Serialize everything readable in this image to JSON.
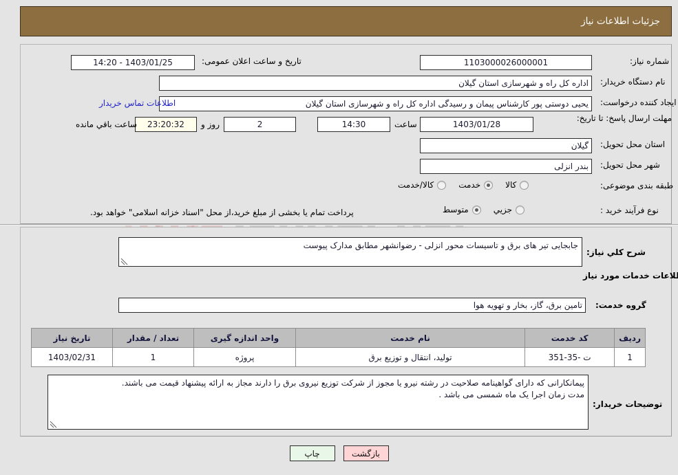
{
  "header": {
    "title": "جزئیات اطلاعات نیاز"
  },
  "colors": {
    "header_brown": "#8d6e40",
    "link_blue": "#2323c8",
    "table_header_gray": "#bebebe",
    "countdown_cream": "#ffffeb",
    "print_button_green": "#e9f7e9",
    "back_button_pink": "#ffd5d5"
  },
  "form": {
    "need_number_label": "شماره نیاز:",
    "need_number_value": "1103000026000001",
    "announce_datetime_label": "تاریخ و ساعت اعلان عمومی:",
    "announce_datetime_value": "1403/01/25 - 14:20",
    "buyer_org_label": "نام دستگاه خریدار:",
    "buyer_org_value": "اداره کل راه و شهرسازی استان گیلان",
    "requester_label": "ایجاد کننده درخواست:",
    "requester_value": "یحیی دوستی پور کارشناس پیمان و رسیدگی اداره کل راه و شهرسازی استان گیلان",
    "buyer_contact_link": "اطلاعات تماس خریدار",
    "deadline_label": "مهلت ارسال پاسخ: تا تاریخ:",
    "deadline_date_value": "1403/01/28",
    "hour_label": "ساعت",
    "deadline_time_value": "14:30",
    "days_value": "2",
    "days_label": "روز و",
    "countdown_value": "23:20:32",
    "remaining_label": "ساعت باقي مانده",
    "delivery_province_label": "استان محل تحویل:",
    "delivery_province_value": "گیلان",
    "delivery_city_label": "شهر محل تحویل:",
    "delivery_city_value": "بندر انزلی",
    "category_label": "طبقه بندی موضوعی:",
    "category_options": [
      {
        "label": "کالا",
        "selected": false
      },
      {
        "label": "خدمت",
        "selected": true
      },
      {
        "label": "کالا/خدمت",
        "selected": false
      }
    ],
    "process_type_label": "نوع فرآیند خرید :",
    "process_type_options": [
      {
        "label": "جزیي",
        "selected": false
      },
      {
        "label": "متوسط",
        "selected": true
      }
    ],
    "treasury_note": "پرداخت تمام یا بخشی از مبلغ خرید،از محل \"اسناد خزانه اسلامی\" خواهد بود."
  },
  "details": {
    "general_desc_label": "شرح کلي نیاز:",
    "general_desc_value": "جابجایی تیر های برق و تاسیسات محور انزلی - رضوانشهر مطابق مدارک پیوست",
    "services_section_title": "اطلاعات خدمات مورد نیاز",
    "service_group_label": "گروه خدمت:",
    "service_group_value": "تامین برق، گاز، بخار و تهویه هوا"
  },
  "table": {
    "columns": [
      "ردیف",
      "کد خدمت",
      "نام خدمت",
      "واحد اندازه گیری",
      "تعداد / مقدار",
      "تاریخ نیاز"
    ],
    "rows": [
      {
        "row_no": "1",
        "service_code": "ت -35-351",
        "service_name": "تولید، انتقال و توزیع برق",
        "unit": "پروژه",
        "quantity": "1",
        "need_date": "1403/02/31"
      }
    ]
  },
  "notes": {
    "buyer_notes_label": "توضیحات خریدار:",
    "buyer_notes_line1": "پیمانکارانی که دارای گواهینامه صلاحیت در رشته نیرو یا مجوز از شرکت توزیع نیروی برق را دارند مجاز به ارائه پیشنهاد قیمت می باشند.",
    "buyer_notes_line2": "مدت زمان اجرا یک ماه شمسی می باشد ."
  },
  "buttons": {
    "print_label": "چاپ",
    "back_label": "بازگشت"
  },
  "watermark": {
    "text_left": "Ana",
    "text_right": "Tender.net"
  }
}
